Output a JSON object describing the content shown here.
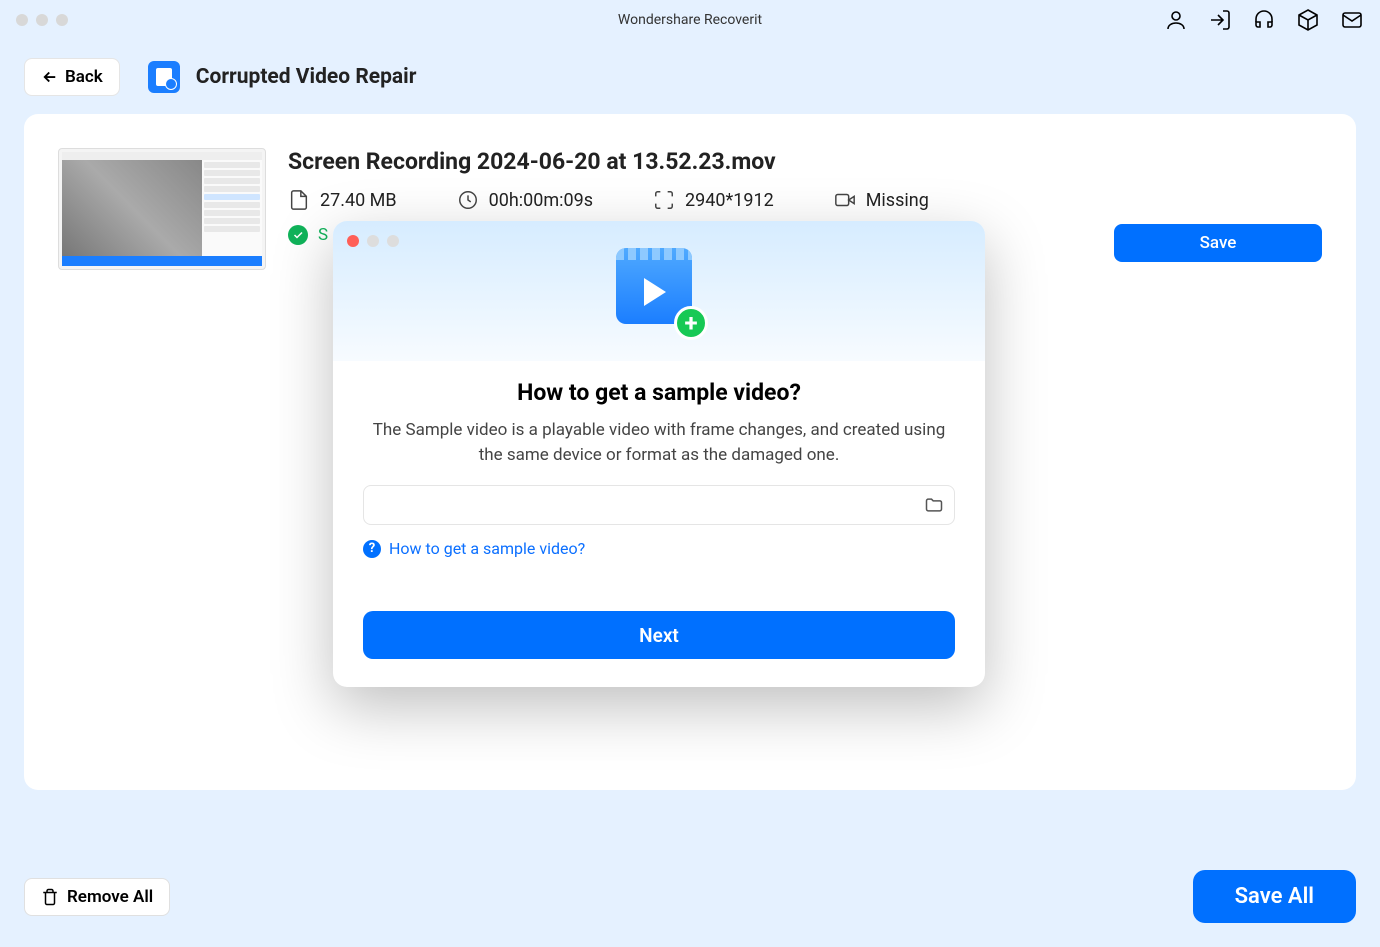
{
  "app_title": "Wondershare Recoverit",
  "back_label": "Back",
  "page_title": "Corrupted Video Repair",
  "file": {
    "name": "Screen Recording 2024-06-20 at 13.52.23.mov",
    "size": "27.40 MB",
    "duration": "00h:00m:09s",
    "resolution": "2940*1912",
    "camera": "Missing",
    "status": "S"
  },
  "save_label": "Save",
  "remove_all_label": "Remove All",
  "save_all_label": "Save All",
  "modal": {
    "title": "How to get a sample video?",
    "desc": "The Sample video is a playable video with frame changes, and created using the same device or format as the damaged one.",
    "path": "",
    "help_link": "How to get a sample video?",
    "next_label": "Next"
  }
}
